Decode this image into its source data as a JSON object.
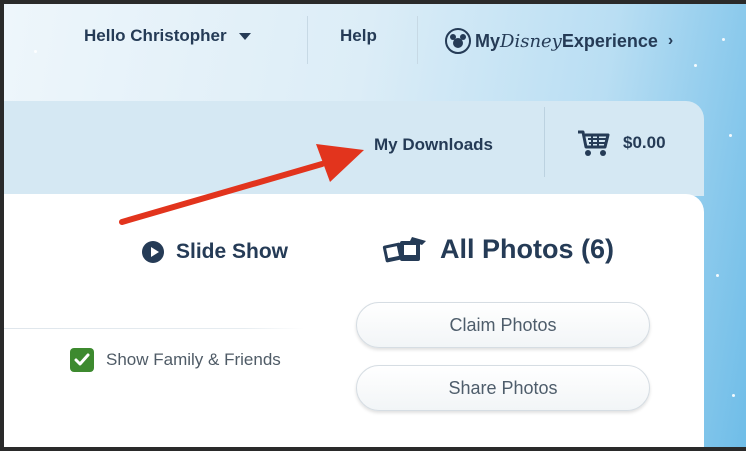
{
  "topnav": {
    "greeting": "Hello Christopher",
    "help": "Help",
    "brand": {
      "prefix": "My",
      "script": "Disney",
      "suffix": "Experience"
    },
    "brand_chevron": "›"
  },
  "subbar": {
    "downloads": "My Downloads",
    "cart_total": "$0.00"
  },
  "content": {
    "slideshow": "Slide Show",
    "all_photos": "All Photos (6)",
    "show_family": "Show Family & Friends",
    "show_family_checked": true,
    "claim": "Claim Photos",
    "share": "Share Photos"
  },
  "icons": {
    "caret": "caret-down-icon",
    "mickey": "mickey-logo-icon",
    "cart": "shopping-cart-icon",
    "play": "play-circle-icon",
    "photos": "photos-icon",
    "check": "checkmark-icon"
  },
  "colors": {
    "navy": "#253b56",
    "subbar": "#d5e8f3",
    "checkbox": "#3d8a2f",
    "arrow": "#e2341d"
  }
}
